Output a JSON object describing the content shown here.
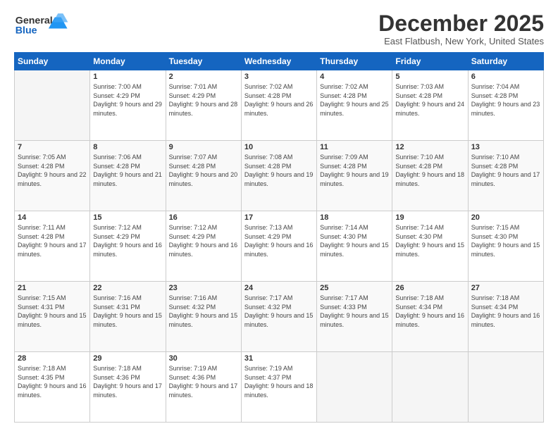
{
  "header": {
    "logo_line1": "General",
    "logo_line2": "Blue",
    "title": "December 2025",
    "location": "East Flatbush, New York, United States"
  },
  "weekdays": [
    "Sunday",
    "Monday",
    "Tuesday",
    "Wednesday",
    "Thursday",
    "Friday",
    "Saturday"
  ],
  "weeks": [
    [
      {
        "day": "",
        "sunrise": "",
        "sunset": "",
        "daylight": ""
      },
      {
        "day": "1",
        "sunrise": "Sunrise: 7:00 AM",
        "sunset": "Sunset: 4:29 PM",
        "daylight": "Daylight: 9 hours and 29 minutes."
      },
      {
        "day": "2",
        "sunrise": "Sunrise: 7:01 AM",
        "sunset": "Sunset: 4:29 PM",
        "daylight": "Daylight: 9 hours and 28 minutes."
      },
      {
        "day": "3",
        "sunrise": "Sunrise: 7:02 AM",
        "sunset": "Sunset: 4:28 PM",
        "daylight": "Daylight: 9 hours and 26 minutes."
      },
      {
        "day": "4",
        "sunrise": "Sunrise: 7:02 AM",
        "sunset": "Sunset: 4:28 PM",
        "daylight": "Daylight: 9 hours and 25 minutes."
      },
      {
        "day": "5",
        "sunrise": "Sunrise: 7:03 AM",
        "sunset": "Sunset: 4:28 PM",
        "daylight": "Daylight: 9 hours and 24 minutes."
      },
      {
        "day": "6",
        "sunrise": "Sunrise: 7:04 AM",
        "sunset": "Sunset: 4:28 PM",
        "daylight": "Daylight: 9 hours and 23 minutes."
      }
    ],
    [
      {
        "day": "7",
        "sunrise": "Sunrise: 7:05 AM",
        "sunset": "Sunset: 4:28 PM",
        "daylight": "Daylight: 9 hours and 22 minutes."
      },
      {
        "day": "8",
        "sunrise": "Sunrise: 7:06 AM",
        "sunset": "Sunset: 4:28 PM",
        "daylight": "Daylight: 9 hours and 21 minutes."
      },
      {
        "day": "9",
        "sunrise": "Sunrise: 7:07 AM",
        "sunset": "Sunset: 4:28 PM",
        "daylight": "Daylight: 9 hours and 20 minutes."
      },
      {
        "day": "10",
        "sunrise": "Sunrise: 7:08 AM",
        "sunset": "Sunset: 4:28 PM",
        "daylight": "Daylight: 9 hours and 19 minutes."
      },
      {
        "day": "11",
        "sunrise": "Sunrise: 7:09 AM",
        "sunset": "Sunset: 4:28 PM",
        "daylight": "Daylight: 9 hours and 19 minutes."
      },
      {
        "day": "12",
        "sunrise": "Sunrise: 7:10 AM",
        "sunset": "Sunset: 4:28 PM",
        "daylight": "Daylight: 9 hours and 18 minutes."
      },
      {
        "day": "13",
        "sunrise": "Sunrise: 7:10 AM",
        "sunset": "Sunset: 4:28 PM",
        "daylight": "Daylight: 9 hours and 17 minutes."
      }
    ],
    [
      {
        "day": "14",
        "sunrise": "Sunrise: 7:11 AM",
        "sunset": "Sunset: 4:28 PM",
        "daylight": "Daylight: 9 hours and 17 minutes."
      },
      {
        "day": "15",
        "sunrise": "Sunrise: 7:12 AM",
        "sunset": "Sunset: 4:29 PM",
        "daylight": "Daylight: 9 hours and 16 minutes."
      },
      {
        "day": "16",
        "sunrise": "Sunrise: 7:12 AM",
        "sunset": "Sunset: 4:29 PM",
        "daylight": "Daylight: 9 hours and 16 minutes."
      },
      {
        "day": "17",
        "sunrise": "Sunrise: 7:13 AM",
        "sunset": "Sunset: 4:29 PM",
        "daylight": "Daylight: 9 hours and 16 minutes."
      },
      {
        "day": "18",
        "sunrise": "Sunrise: 7:14 AM",
        "sunset": "Sunset: 4:30 PM",
        "daylight": "Daylight: 9 hours and 15 minutes."
      },
      {
        "day": "19",
        "sunrise": "Sunrise: 7:14 AM",
        "sunset": "Sunset: 4:30 PM",
        "daylight": "Daylight: 9 hours and 15 minutes."
      },
      {
        "day": "20",
        "sunrise": "Sunrise: 7:15 AM",
        "sunset": "Sunset: 4:30 PM",
        "daylight": "Daylight: 9 hours and 15 minutes."
      }
    ],
    [
      {
        "day": "21",
        "sunrise": "Sunrise: 7:15 AM",
        "sunset": "Sunset: 4:31 PM",
        "daylight": "Daylight: 9 hours and 15 minutes."
      },
      {
        "day": "22",
        "sunrise": "Sunrise: 7:16 AM",
        "sunset": "Sunset: 4:31 PM",
        "daylight": "Daylight: 9 hours and 15 minutes."
      },
      {
        "day": "23",
        "sunrise": "Sunrise: 7:16 AM",
        "sunset": "Sunset: 4:32 PM",
        "daylight": "Daylight: 9 hours and 15 minutes."
      },
      {
        "day": "24",
        "sunrise": "Sunrise: 7:17 AM",
        "sunset": "Sunset: 4:32 PM",
        "daylight": "Daylight: 9 hours and 15 minutes."
      },
      {
        "day": "25",
        "sunrise": "Sunrise: 7:17 AM",
        "sunset": "Sunset: 4:33 PM",
        "daylight": "Daylight: 9 hours and 15 minutes."
      },
      {
        "day": "26",
        "sunrise": "Sunrise: 7:18 AM",
        "sunset": "Sunset: 4:34 PM",
        "daylight": "Daylight: 9 hours and 16 minutes."
      },
      {
        "day": "27",
        "sunrise": "Sunrise: 7:18 AM",
        "sunset": "Sunset: 4:34 PM",
        "daylight": "Daylight: 9 hours and 16 minutes."
      }
    ],
    [
      {
        "day": "28",
        "sunrise": "Sunrise: 7:18 AM",
        "sunset": "Sunset: 4:35 PM",
        "daylight": "Daylight: 9 hours and 16 minutes."
      },
      {
        "day": "29",
        "sunrise": "Sunrise: 7:18 AM",
        "sunset": "Sunset: 4:36 PM",
        "daylight": "Daylight: 9 hours and 17 minutes."
      },
      {
        "day": "30",
        "sunrise": "Sunrise: 7:19 AM",
        "sunset": "Sunset: 4:36 PM",
        "daylight": "Daylight: 9 hours and 17 minutes."
      },
      {
        "day": "31",
        "sunrise": "Sunrise: 7:19 AM",
        "sunset": "Sunset: 4:37 PM",
        "daylight": "Daylight: 9 hours and 18 minutes."
      },
      {
        "day": "",
        "sunrise": "",
        "sunset": "",
        "daylight": ""
      },
      {
        "day": "",
        "sunrise": "",
        "sunset": "",
        "daylight": ""
      },
      {
        "day": "",
        "sunrise": "",
        "sunset": "",
        "daylight": ""
      }
    ]
  ]
}
